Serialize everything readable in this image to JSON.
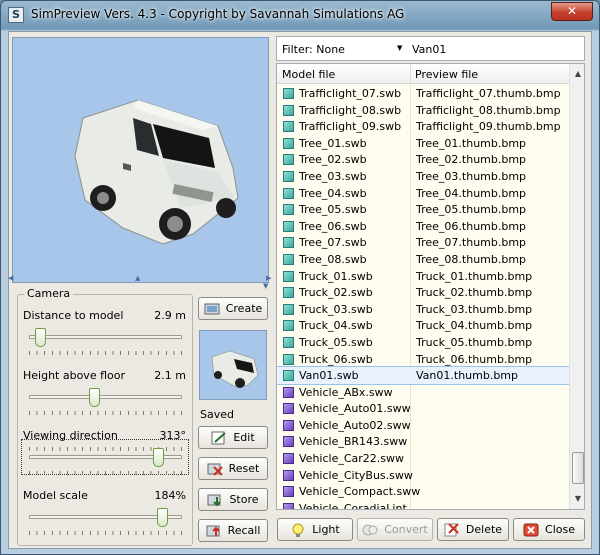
{
  "window": {
    "title": "SimPreview Vers. 4.3 - Copyright by Savannah Simulations AG",
    "app_icon": "S",
    "close_label": "✕"
  },
  "camera": {
    "legend": "Camera",
    "distance": {
      "label": "Distance to model",
      "value": "2.9 m",
      "level": 0.04
    },
    "height": {
      "label": "Height above floor",
      "value": "2.1 m",
      "level": 0.42
    },
    "direction": {
      "label": "Viewing direction",
      "value": "313°",
      "level": 0.87
    },
    "scale": {
      "label": "Model scale",
      "value": "184%",
      "level": 0.9
    }
  },
  "buttons": {
    "create": "Create",
    "edit": "Edit",
    "reset": "Reset",
    "store": "Store",
    "recall": "Recall",
    "light": "Light",
    "convert": "Convert",
    "delete": "Delete",
    "close": "Close"
  },
  "saved_label": "Saved",
  "filter": {
    "value": "Filter: None",
    "search": "Van01"
  },
  "list": {
    "col1": "Model file",
    "col2": "Preview file",
    "rows": [
      {
        "model": "Trafficlight_07.swb",
        "preview": "Trafficlight_07.thumb.bmp",
        "icon": "teal"
      },
      {
        "model": "Trafficlight_08.swb",
        "preview": "Trafficlight_08.thumb.bmp",
        "icon": "teal"
      },
      {
        "model": "Trafficlight_09.swb",
        "preview": "Trafficlight_09.thumb.bmp",
        "icon": "teal"
      },
      {
        "model": "Tree_01.swb",
        "preview": "Tree_01.thumb.bmp",
        "icon": "teal"
      },
      {
        "model": "Tree_02.swb",
        "preview": "Tree_02.thumb.bmp",
        "icon": "teal"
      },
      {
        "model": "Tree_03.swb",
        "preview": "Tree_03.thumb.bmp",
        "icon": "teal"
      },
      {
        "model": "Tree_04.swb",
        "preview": "Tree_04.thumb.bmp",
        "icon": "teal"
      },
      {
        "model": "Tree_05.swb",
        "preview": "Tree_05.thumb.bmp",
        "icon": "teal"
      },
      {
        "model": "Tree_06.swb",
        "preview": "Tree_06.thumb.bmp",
        "icon": "teal"
      },
      {
        "model": "Tree_07.swb",
        "preview": "Tree_07.thumb.bmp",
        "icon": "teal"
      },
      {
        "model": "Tree_08.swb",
        "preview": "Tree_08.thumb.bmp",
        "icon": "teal"
      },
      {
        "model": "Truck_01.swb",
        "preview": "Truck_01.thumb.bmp",
        "icon": "teal"
      },
      {
        "model": "Truck_02.swb",
        "preview": "Truck_02.thumb.bmp",
        "icon": "teal"
      },
      {
        "model": "Truck_03.swb",
        "preview": "Truck_03.thumb.bmp",
        "icon": "teal"
      },
      {
        "model": "Truck_04.swb",
        "preview": "Truck_04.thumb.bmp",
        "icon": "teal"
      },
      {
        "model": "Truck_05.swb",
        "preview": "Truck_05.thumb.bmp",
        "icon": "teal"
      },
      {
        "model": "Truck_06.swb",
        "preview": "Truck_06.thumb.bmp",
        "icon": "teal"
      },
      {
        "model": "Van01.swb",
        "preview": "Van01.thumb.bmp",
        "icon": "teal",
        "selected": true
      },
      {
        "model": "Vehicle_ABx.sww",
        "preview": "",
        "icon": "violet"
      },
      {
        "model": "Vehicle_Auto01.sww",
        "preview": "",
        "icon": "violet"
      },
      {
        "model": "Vehicle_Auto02.sww",
        "preview": "",
        "icon": "violet"
      },
      {
        "model": "Vehicle_BR143.sww",
        "preview": "",
        "icon": "violet"
      },
      {
        "model": "Vehicle_Car22.sww",
        "preview": "",
        "icon": "violet"
      },
      {
        "model": "Vehicle_CityBus.sww",
        "preview": "",
        "icon": "violet"
      },
      {
        "model": "Vehicle_Compact.sww",
        "preview": "",
        "icon": "violet"
      },
      {
        "model": "Vehicle_CoradiaLint...",
        "preview": "",
        "icon": "violet"
      }
    ]
  },
  "scroll_position": 0.9
}
